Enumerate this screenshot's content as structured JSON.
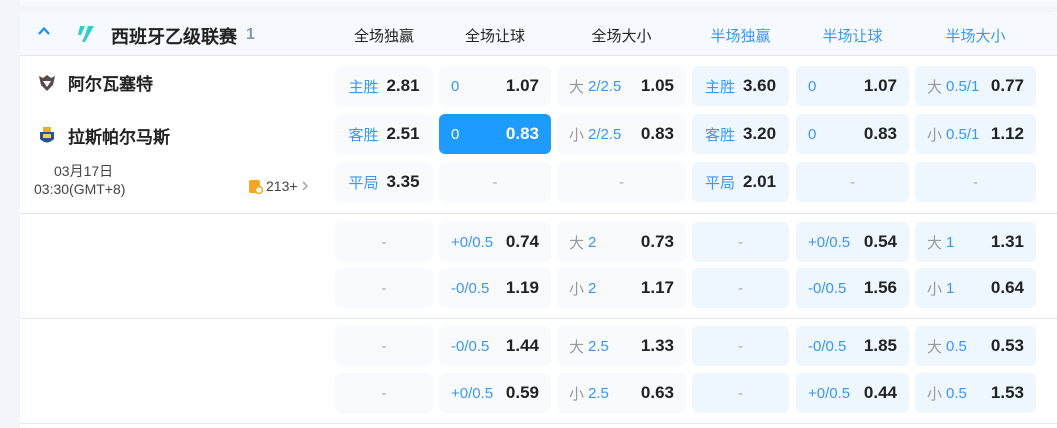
{
  "league": {
    "name": "西班牙乙级联赛",
    "count": "1"
  },
  "columns": [
    "全场独赢",
    "全场让球",
    "全场大小",
    "半场独赢",
    "半场让球",
    "半场大小"
  ],
  "match": {
    "home": "阿尔瓦塞特",
    "away": "拉斯帕尔马斯",
    "date": "03月17日",
    "time": "03:30(GMT+8)",
    "more_count": "213+"
  },
  "colors": {
    "accent": "#1e9bff",
    "label": "#3b97f5"
  },
  "rows": [
    [
      {
        "lab": "主胜",
        "odds": "2.81"
      },
      {
        "line": "0",
        "odds": "1.07"
      },
      {
        "pre": "大",
        "line": "2/2.5",
        "odds": "1.05"
      },
      {
        "lab": "主胜",
        "odds": "3.60"
      },
      {
        "line": "0",
        "odds": "1.07"
      },
      {
        "pre": "大",
        "line": "0.5/1",
        "odds": "0.77"
      }
    ],
    [
      {
        "lab": "客胜",
        "odds": "2.51"
      },
      {
        "line": "0",
        "odds": "0.83",
        "selected": true
      },
      {
        "pre": "小",
        "line": "2/2.5",
        "odds": "0.83"
      },
      {
        "lab": "客胜",
        "odds": "3.20"
      },
      {
        "line": "0",
        "odds": "0.83"
      },
      {
        "pre": "小",
        "line": "0.5/1",
        "odds": "1.12"
      }
    ],
    [
      {
        "lab": "平局",
        "odds": "3.35"
      },
      {
        "dash": "-"
      },
      {
        "dash": "-"
      },
      {
        "lab": "平局",
        "odds": "2.01"
      },
      {
        "dash": "-"
      },
      {
        "dash": "-"
      }
    ],
    [
      {
        "dash": "-"
      },
      {
        "line": "+0/0.5",
        "odds": "0.74"
      },
      {
        "pre": "大",
        "line": "2",
        "odds": "0.73"
      },
      {
        "dash": "-"
      },
      {
        "line": "+0/0.5",
        "odds": "0.54"
      },
      {
        "pre": "大",
        "line": "1",
        "odds": "1.31"
      }
    ],
    [
      {
        "dash": "-"
      },
      {
        "line": "-0/0.5",
        "odds": "1.19"
      },
      {
        "pre": "小",
        "line": "2",
        "odds": "1.17"
      },
      {
        "dash": "-"
      },
      {
        "line": "-0/0.5",
        "odds": "1.56"
      },
      {
        "pre": "小",
        "line": "1",
        "odds": "0.64"
      }
    ],
    [
      {
        "dash": "-"
      },
      {
        "line": "-0/0.5",
        "odds": "1.44"
      },
      {
        "pre": "大",
        "line": "2.5",
        "odds": "1.33"
      },
      {
        "dash": "-"
      },
      {
        "line": "-0/0.5",
        "odds": "1.85"
      },
      {
        "pre": "大",
        "line": "0.5",
        "odds": "0.53"
      }
    ],
    [
      {
        "dash": "-"
      },
      {
        "line": "+0/0.5",
        "odds": "0.59"
      },
      {
        "pre": "小",
        "line": "2.5",
        "odds": "0.63"
      },
      {
        "dash": "-"
      },
      {
        "line": "+0/0.5",
        "odds": "0.44"
      },
      {
        "pre": "小",
        "line": "0.5",
        "odds": "1.53"
      }
    ]
  ]
}
